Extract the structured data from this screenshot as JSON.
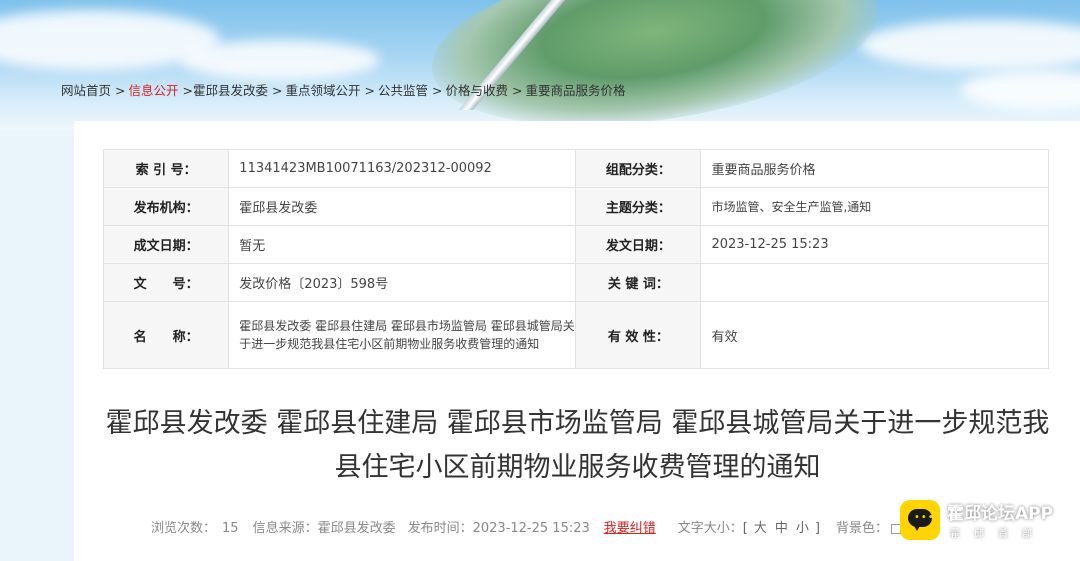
{
  "breadcrumb": [
    {
      "label": "网站首页",
      "highlight": false
    },
    {
      "label": "信息公开",
      "highlight": true
    },
    {
      "label": "霍邱县发改委",
      "highlight": false
    },
    {
      "label": "重点领域公开",
      "highlight": false
    },
    {
      "label": "公共监管",
      "highlight": false
    },
    {
      "label": "价格与收费",
      "highlight": false
    },
    {
      "label": "重要商品服务价格",
      "highlight": false
    }
  ],
  "meta": {
    "index_label": "索 引 号：",
    "index_value": "11341423MB10071163/202312-00092",
    "category_label": "组配分类：",
    "category_value": "重要商品服务价格",
    "org_label": "发布机构：",
    "org_value": "霍邱县发改委",
    "topic_label": "主题分类：",
    "topic_value": "市场监管、安全生产监管,通知",
    "created_label": "成文日期：",
    "created_value": "暂无",
    "published_label": "发文日期：",
    "published_value": "2023-12-25 15:23",
    "docno_label": "文　　号：",
    "docno_value": "发改价格〔2023〕598号",
    "keywords_label": "关 键 词：",
    "keywords_value": "",
    "name_label": "名　　称：",
    "name_value": "霍邱县发改委 霍邱县住建局 霍邱县市场监管局 霍邱县城管局关于进一步规范我县住宅小区前期物业服务收费管理的通知",
    "validity_label": "有 效 性：",
    "validity_value": "有效"
  },
  "article": {
    "title": "霍邱县发改委 霍邱县住建局 霍邱县市场监管局 霍邱县城管局关于进一步规范我县住宅小区前期物业服务收费管理的通知"
  },
  "info": {
    "views_label": "浏览次数：",
    "views_value": "15",
    "source_label": "信息来源：",
    "source_value": "霍邱县发改委",
    "time_label": "发布时间：",
    "time_value": "2023-12-25 15:23",
    "error_link": "我要纠错",
    "fontsize_label": "文字大小：",
    "fontsize_open": "[",
    "fontsize_large": "大",
    "fontsize_medium": "中",
    "fontsize_small": "小",
    "fontsize_close": "]",
    "bgcolor_label": "背景色："
  },
  "app_badge": {
    "name": "霍邱论坛APP",
    "subtitle": "霍邱首部"
  },
  "colors": {
    "accent_red": "#d8211d",
    "app_yellow": "#ffd400"
  }
}
